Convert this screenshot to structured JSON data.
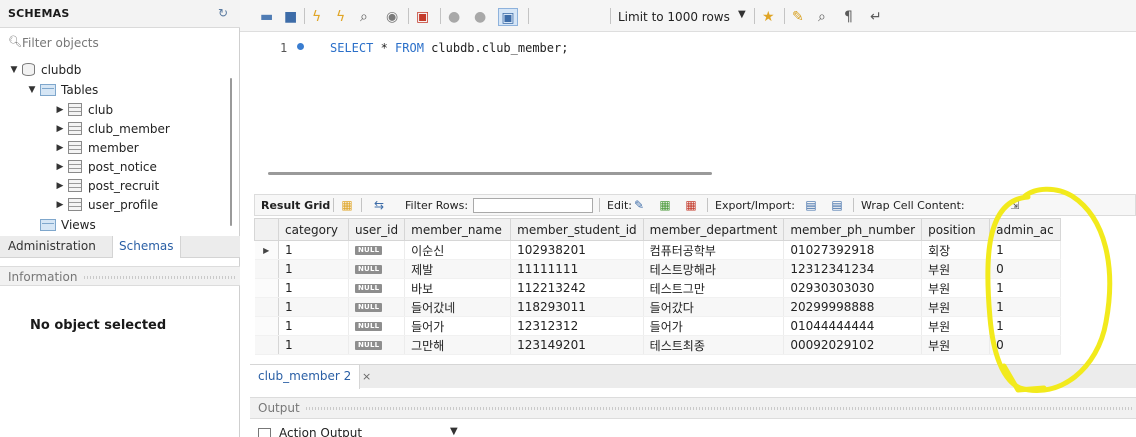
{
  "sidebar": {
    "title": "SCHEMAS",
    "filter_placeholder": "Filter objects",
    "schema": "clubdb",
    "tables_folder": "Tables",
    "tables": [
      "club",
      "club_member",
      "member",
      "post_notice",
      "post_recruit",
      "user_profile"
    ],
    "views_folder": "Views",
    "tabs": {
      "administration": "Administration",
      "schemas": "Schemas"
    },
    "info_title": "Information",
    "no_object": "No object selected"
  },
  "toolbar": {
    "limit_label": "Limit to 1000 rows"
  },
  "editor": {
    "line_number": "1",
    "sql": {
      "select": "SELECT",
      "star": " * ",
      "from": "FROM",
      "rest": " clubdb.club_member;"
    }
  },
  "result_toolbar": {
    "result_grid": "Result Grid",
    "filter_rows": "Filter Rows:",
    "edit": "Edit:",
    "export_import": "Export/Import:",
    "wrap": "Wrap Cell Content:"
  },
  "grid": {
    "null_label": "NULL",
    "columns": [
      "category",
      "user_id",
      "member_name",
      "member_student_id",
      "member_department",
      "member_ph_number",
      "position",
      "admin_ac"
    ],
    "rows": [
      [
        "1",
        "NULL",
        "이순신",
        "102938201",
        "컴퓨터공학부",
        "01027392918",
        "회장",
        "1"
      ],
      [
        "1",
        "NULL",
        "제발",
        "11111111",
        "테스트망해라",
        "12312341234",
        "부원",
        "0"
      ],
      [
        "1",
        "NULL",
        "바보",
        "112213242",
        "테스트그만",
        "02930303030",
        "부원",
        "1"
      ],
      [
        "1",
        "NULL",
        "들어갔네",
        "118293011",
        "들어갔다",
        "20299998888",
        "부원",
        "1"
      ],
      [
        "1",
        "NULL",
        "들어가",
        "12312312",
        "들어가",
        "01044444444",
        "부원",
        "1"
      ],
      [
        "1",
        "NULL",
        "그만해",
        "123149201",
        "테스트최종",
        "00092029102",
        "부원",
        "0"
      ]
    ]
  },
  "result_tab": {
    "label": "club_member 2",
    "close": "×"
  },
  "output": {
    "title": "Output",
    "selector": "Action Output"
  },
  "colors": {
    "accent": "#2a6fc9",
    "annotation": "#f2ea1c",
    "null_badge": "#8e8e8e"
  }
}
